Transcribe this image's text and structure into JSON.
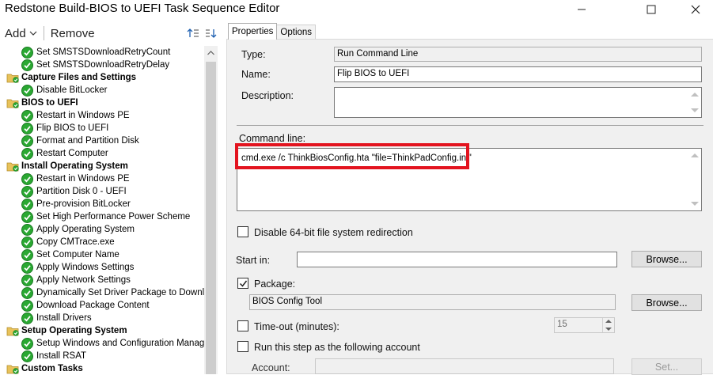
{
  "window": {
    "title": "Redstone Build-BIOS to UEFI Task Sequence Editor",
    "buttons": [
      "minimize-icon",
      "maximize-icon",
      "close-icon"
    ]
  },
  "toolbar": {
    "add_label": "Add",
    "remove_label": "Remove"
  },
  "tree": {
    "items": [
      {
        "label": "Set SMSTSDownloadRetryCount",
        "type": "step"
      },
      {
        "label": "Set SMSTSDownloadRetryDelay",
        "type": "step"
      },
      {
        "label": "Capture Files and Settings",
        "type": "group"
      },
      {
        "label": "Disable BitLocker",
        "type": "step"
      },
      {
        "label": "BIOS to UEFI",
        "type": "group"
      },
      {
        "label": "Restart in Windows PE",
        "type": "step"
      },
      {
        "label": "Flip BIOS to UEFI",
        "type": "step",
        "selected": true
      },
      {
        "label": "Format and Partition Disk",
        "type": "step"
      },
      {
        "label": "Restart Computer",
        "type": "step"
      },
      {
        "label": "Install Operating System",
        "type": "group"
      },
      {
        "label": "Restart in Windows PE",
        "type": "step"
      },
      {
        "label": "Partition Disk 0 - UEFI",
        "type": "step"
      },
      {
        "label": "Pre-provision BitLocker",
        "type": "step"
      },
      {
        "label": "Set High Performance Power Scheme",
        "type": "step"
      },
      {
        "label": "Apply Operating System",
        "type": "step"
      },
      {
        "label": "Copy CMTrace.exe",
        "type": "step"
      },
      {
        "label": "Set Computer Name",
        "type": "step"
      },
      {
        "label": "Apply Windows Settings",
        "type": "step"
      },
      {
        "label": "Apply Network Settings",
        "type": "step"
      },
      {
        "label": "Dynamically Set Driver Package to Downloa",
        "type": "step"
      },
      {
        "label": "Download Package Content",
        "type": "step"
      },
      {
        "label": "Install Drivers",
        "type": "step"
      },
      {
        "label": "Setup Operating System",
        "type": "group"
      },
      {
        "label": "Setup Windows and Configuration Manager",
        "type": "step"
      },
      {
        "label": "Install RSAT",
        "type": "step"
      },
      {
        "label": "Custom Tasks",
        "type": "group"
      }
    ]
  },
  "tabs": [
    {
      "label": "Properties",
      "active": true
    },
    {
      "label": "Options",
      "active": false
    }
  ],
  "properties": {
    "type_label": "Type:",
    "type_value": "Run Command Line",
    "name_label": "Name:",
    "name_value": "Flip BIOS to UEFI",
    "description_label": "Description:",
    "description_value": "",
    "command_line_label": "Command line:",
    "command_line_value": "cmd.exe /c ThinkBiosConfig.hta \"file=ThinkPadConfig.ini\"",
    "disable64_label": "Disable 64-bit file system redirection",
    "disable64_checked": false,
    "start_in_label": "Start in:",
    "start_in_value": "",
    "browse_label": "Browse...",
    "package_label": "Package:",
    "package_checked": true,
    "package_value": "BIOS Config Tool",
    "browse2_label": "Browse...",
    "timeout_label": "Time-out (minutes):",
    "timeout_checked": false,
    "timeout_value": "15",
    "run_as_label": "Run this step as the following account",
    "run_as_checked": false,
    "account_label": "Account:",
    "account_value": "",
    "set_label": "Set..."
  },
  "colors": {
    "highlight": "#e3141f",
    "success_check": "#2aa832",
    "folder": "#e8c25a"
  }
}
